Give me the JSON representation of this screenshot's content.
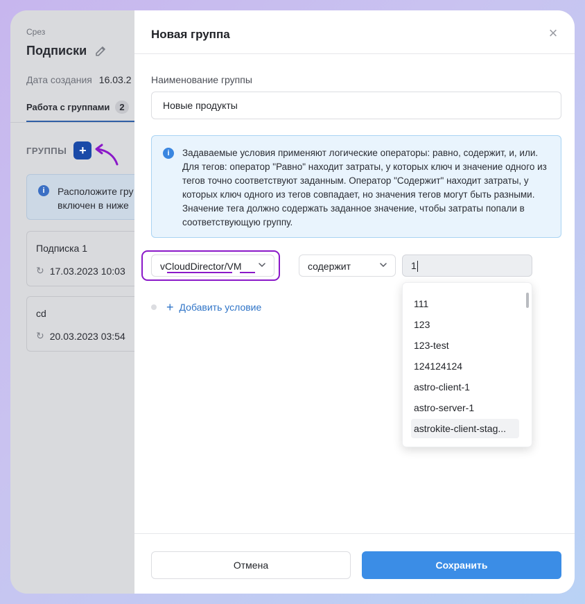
{
  "background": {
    "section_label": "Срез",
    "page_title": "Подписки",
    "created_label": "Дата создания",
    "created_value": "16.03.2",
    "tab_label": "Работа с группами",
    "tab_count": "2",
    "groups_heading": "ГРУППЫ",
    "add_group_symbol": "+",
    "info_text_line1": "Расположите гру",
    "info_text_line2": "включен в ниже",
    "cards": [
      {
        "name": "Подписка 1",
        "date": "17.03.2023 10:03"
      },
      {
        "name": "cd",
        "date": "20.03.2023 03:54"
      }
    ]
  },
  "modal": {
    "title": "Новая группа",
    "close_symbol": "×",
    "name_label": "Наименование группы",
    "name_value": "Новые продукты",
    "info_text": "Задаваемые условия применяют логические операторы: равно, содержит, и, или. Для тегов: оператор \"Равно\" находит затраты, у которых ключ и значение одного из тегов точно соответствуют заданным. Оператор \"Содержит\" находит затраты, у которых ключ одного из тегов совпадает, но значения тегов могут быть разными. Значение тега должно содержать заданное значение, чтобы затраты попали в соответствующую группу.",
    "condition": {
      "key_value": "vCloudDirector/VM",
      "operator_value": "содержит",
      "input_value": "1"
    },
    "dropdown_options": [
      "111",
      "123",
      "123-test",
      "124124124",
      "astro-client-1",
      "astro-server-1",
      "astrokite-client-stag..."
    ],
    "add_condition_label": "Добавить условие",
    "cancel_label": "Отмена",
    "save_label": "Сохранить"
  },
  "colors": {
    "accent": "#3b8de6",
    "annotation": "#8a18c8",
    "info_bg": "#e9f4fd"
  }
}
